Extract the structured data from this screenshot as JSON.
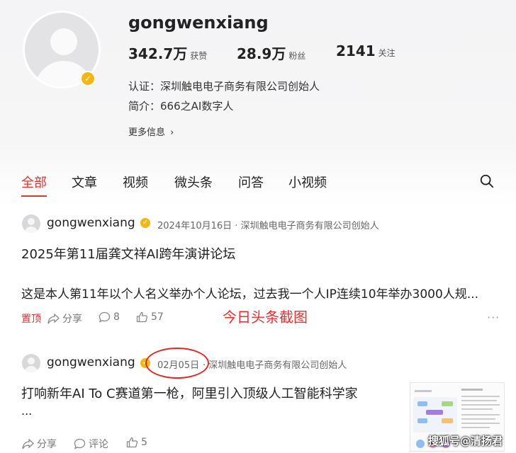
{
  "profile": {
    "username": "gongwenxiang",
    "stats": [
      {
        "value": "342.7万",
        "label": "获赞"
      },
      {
        "value": "28.9万",
        "label": "粉丝"
      },
      {
        "value": "2141",
        "label": "关注"
      }
    ],
    "certification": "认证：深圳触电电子商务有限公司创始人",
    "intro": "简介：666之AI数字人",
    "more_info": "更多信息"
  },
  "tabs": [
    "全部",
    "文章",
    "视频",
    "微头条",
    "问答",
    "小视频"
  ],
  "posts": [
    {
      "author": "gongwenxiang",
      "meta": "2024年10月16日 · 深圳触电电子商务有限公司创始人",
      "title": "2025年第11届龚文祥AI跨年演讲论坛",
      "excerpt": "这是本人第11年以个人名义举办个人论坛，过去我一个人IP连续10年举办3000人规...",
      "pinned": "置顶",
      "share": "分享",
      "comments": "8",
      "likes": "57"
    },
    {
      "author": "gongwenxiang",
      "date": "02月05日",
      "org": "· 深圳触电电子商务有限公司创始人",
      "title": "打响新年AI To C赛道第一枪，阿里引入顶级人工智能科学家",
      "excerpt": "...",
      "share": "分享",
      "comments": "评论",
      "likes": "5"
    }
  ],
  "annotation": "今日头条截图",
  "watermark": "搜狐号@清扬君",
  "colors": {
    "accent": "#e8302e",
    "verified": "#f4b617"
  }
}
